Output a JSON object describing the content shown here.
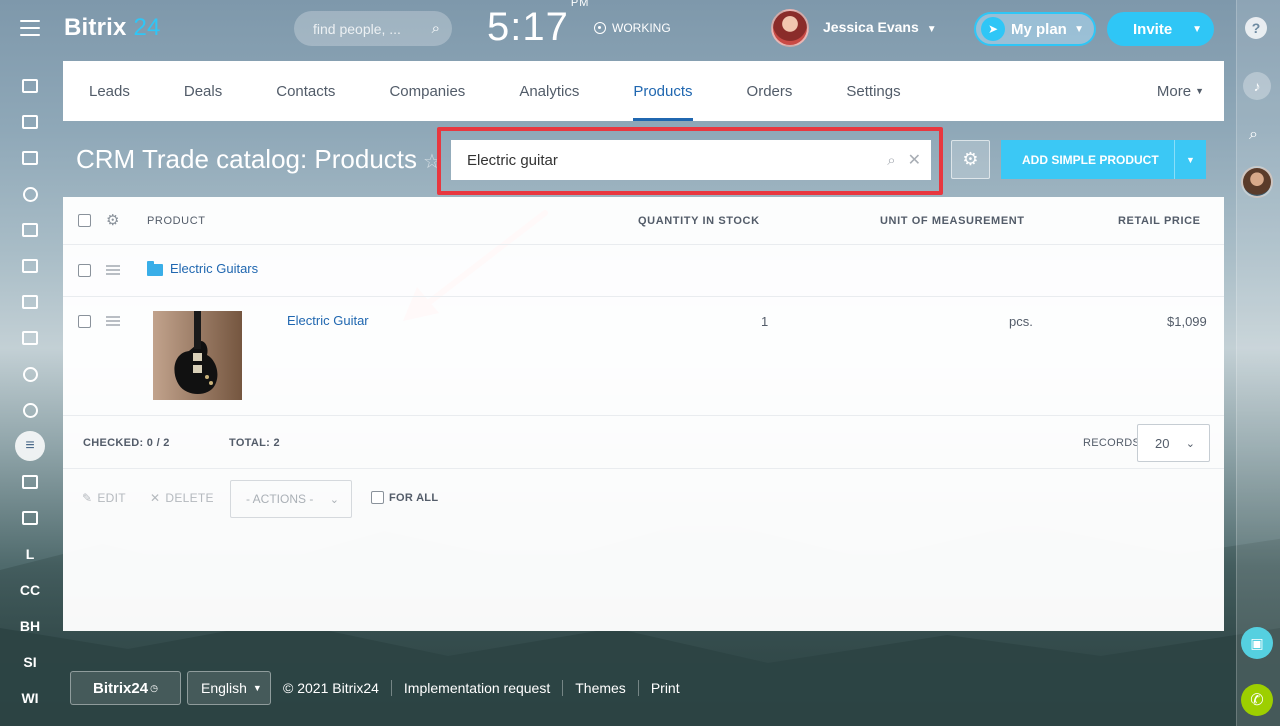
{
  "app": {
    "logo_main": "Bitrix",
    "logo_num": "24"
  },
  "header": {
    "search_placeholder": "find people, ...",
    "time": "5:17",
    "ampm": "PM",
    "status": "WORKING",
    "user_name": "Jessica Evans",
    "my_plan": "My plan",
    "invite": "Invite"
  },
  "left_nav": {
    "letters": [
      "L",
      "CC",
      "BH",
      "SI",
      "WI"
    ]
  },
  "top_nav": {
    "items": [
      "Leads",
      "Deals",
      "Contacts",
      "Companies",
      "Analytics",
      "Products",
      "Orders",
      "Settings"
    ],
    "active": "Products",
    "more": "More"
  },
  "page": {
    "title": "CRM Trade catalog: Products",
    "filter_value": "Electric guitar",
    "add_button": "ADD SIMPLE PRODUCT"
  },
  "grid": {
    "columns": {
      "product": "PRODUCT",
      "quantity": "QUANTITY IN STOCK",
      "unit": "UNIT OF MEASUREMENT",
      "price": "RETAIL PRICE"
    },
    "folder": {
      "name": "Electric Guitars"
    },
    "product": {
      "name": "Electric Guitar",
      "quantity": "1",
      "unit": "pcs.",
      "price": "$1,099"
    },
    "checked": "CHECKED: 0 / 2",
    "total": "TOTAL: 2",
    "records_label": "RECORDS:",
    "records_value": "20",
    "edit": "EDIT",
    "delete": "DELETE",
    "actions": "- ACTIONS -",
    "for_all": "FOR ALL"
  },
  "footer": {
    "brand": "Bitrix24",
    "language": "English",
    "copyright": "© 2021 Bitrix24",
    "implementation": "Implementation request",
    "themes": "Themes",
    "print": "Print"
  },
  "colors": {
    "accent": "#2fc6f6",
    "link": "#2067b0",
    "highlight": "#e8373f"
  }
}
